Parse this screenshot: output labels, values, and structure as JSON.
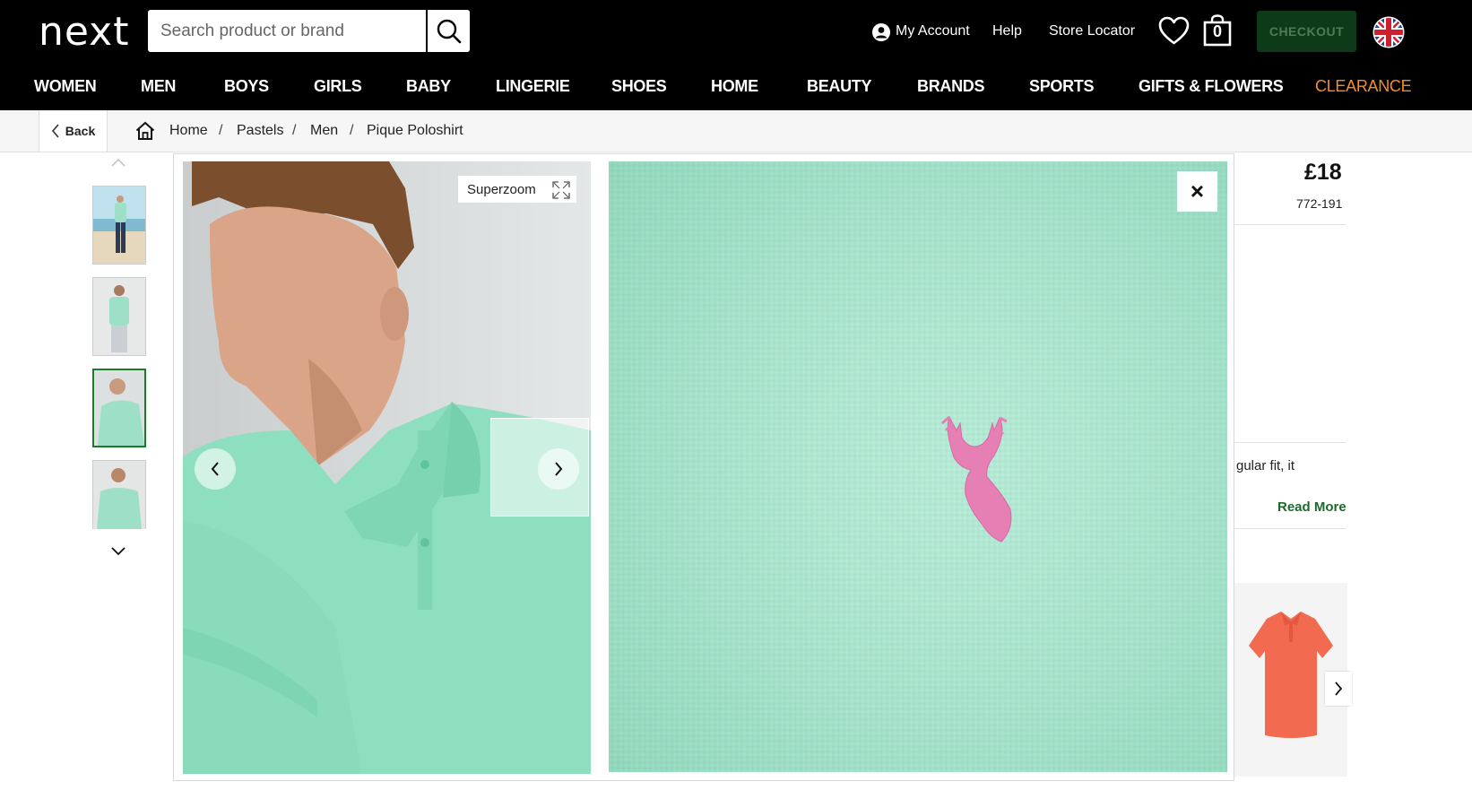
{
  "header": {
    "logo": "next",
    "search_placeholder": "Search product or brand",
    "my_account": "My Account",
    "help": "Help",
    "store_locator": "Store Locator",
    "bag_count": "0",
    "checkout": "CHECKOUT",
    "icons": [
      "search-icon",
      "account-icon",
      "heart-icon",
      "bag-icon",
      "uk-flag-icon"
    ]
  },
  "nav": {
    "items": [
      "WOMEN",
      "MEN",
      "BOYS",
      "GIRLS",
      "BABY",
      "LINGERIE",
      "SHOES",
      "HOME",
      "BEAUTY",
      "BRANDS",
      "SPORTS",
      "GIFTS & FLOWERS",
      "CLEARANCE"
    ],
    "clearance_color": "#f28e2b"
  },
  "breadcrumb": {
    "back": "Back",
    "items": [
      "Home",
      "Pastels",
      "Men",
      "Pique Poloshirt"
    ],
    "separator": "/"
  },
  "gallery": {
    "superzoom_label": "Superzoom",
    "close": "×",
    "active_thumb": 3
  },
  "product": {
    "price": "£18",
    "code": "772-191",
    "description_fragment": "gular fit, it",
    "read_more": "Read More"
  },
  "colors": {
    "accent_green": "#1d6b2c",
    "checkout_bg": "#0d3b1a",
    "shirt_mint": "#a6e4cc",
    "stag_pink": "#e680b4"
  }
}
